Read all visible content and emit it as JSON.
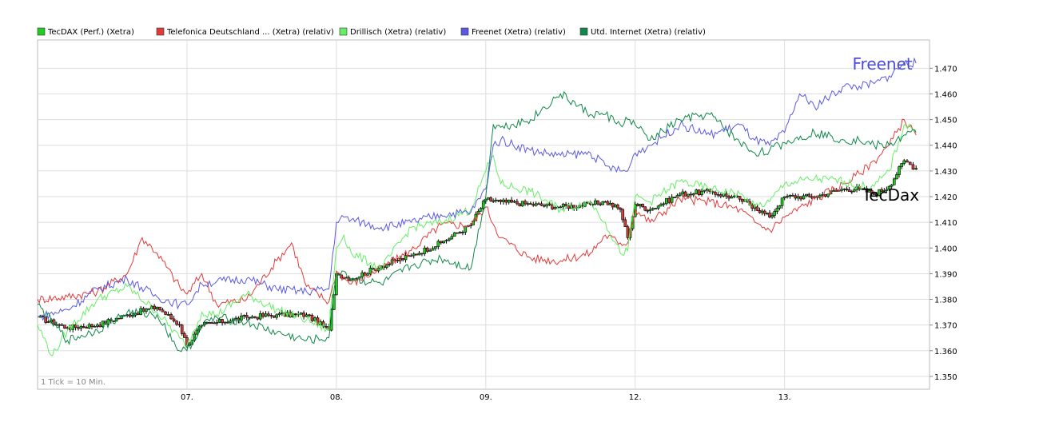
{
  "chart_data": {
    "type": "line",
    "footnote": "1 Tick = 10 Min.",
    "annotations": [
      {
        "text": "Freenet",
        "series": "Freenet (Xetra) (relativ)",
        "x": 5.55,
        "y": 1.4695,
        "color": "#4b4bd6"
      },
      {
        "text": "TecDax",
        "series": "TecDAX (Perf.) (Xetra)",
        "x": 5.55,
        "y": 1.421,
        "color": "#000000"
      }
    ],
    "x_ticks": [
      {
        "x": 1,
        "label": "07."
      },
      {
        "x": 2,
        "label": "08."
      },
      {
        "x": 3,
        "label": "09."
      },
      {
        "x": 4,
        "label": "12."
      },
      {
        "x": 5,
        "label": "13."
      }
    ],
    "xlim": [
      0,
      5.97
    ],
    "ylim": [
      1.345,
      1.481
    ],
    "y_ticks": [
      1.35,
      1.36,
      1.37,
      1.38,
      1.39,
      1.4,
      1.41,
      1.42,
      1.43,
      1.44,
      1.45,
      1.46,
      1.47
    ],
    "y_tick_labels": [
      "1.350",
      "1.360",
      "1.370",
      "1.380",
      "1.390",
      "1.400",
      "1.410",
      "1.420",
      "1.430",
      "1.440",
      "1.450",
      "1.460",
      "1.470"
    ],
    "grid": true,
    "legend_position": "top",
    "series": [
      {
        "name": "TecDAX (Perf.) (Xetra)",
        "color": "#22cc22",
        "style": "candlestick",
        "x": [
          0,
          0.2,
          0.4,
          0.6,
          0.8,
          0.95,
          1.0,
          1.1,
          1.2,
          1.4,
          1.6,
          1.8,
          1.95,
          2.0,
          2.1,
          2.3,
          2.5,
          2.7,
          2.9,
          3.0,
          3.1,
          3.3,
          3.5,
          3.7,
          3.8,
          3.9,
          3.95,
          4.0,
          4.1,
          4.3,
          4.5,
          4.7,
          4.8,
          4.9,
          5.0,
          5.2,
          5.4,
          5.5,
          5.6,
          5.7,
          5.8,
          5.88
        ],
        "y": [
          1.373,
          1.369,
          1.37,
          1.374,
          1.377,
          1.37,
          1.362,
          1.37,
          1.371,
          1.373,
          1.374,
          1.374,
          1.368,
          1.39,
          1.388,
          1.393,
          1.397,
          1.402,
          1.409,
          1.419,
          1.418,
          1.417,
          1.416,
          1.417,
          1.418,
          1.415,
          1.404,
          1.417,
          1.415,
          1.421,
          1.422,
          1.419,
          1.416,
          1.412,
          1.42,
          1.42,
          1.423,
          1.423,
          1.421,
          1.424,
          1.434,
          1.431
        ]
      },
      {
        "name": "Telefonica Deutschland ... (Xetra) (relativ)",
        "color": "#e23b3b",
        "style": "line",
        "x": [
          0,
          0.2,
          0.4,
          0.6,
          0.7,
          0.8,
          0.95,
          1.0,
          1.1,
          1.2,
          1.4,
          1.6,
          1.7,
          1.8,
          1.95,
          2.0,
          2.1,
          2.3,
          2.5,
          2.7,
          2.9,
          3.0,
          3.1,
          3.3,
          3.5,
          3.7,
          3.8,
          3.9,
          3.95,
          4.0,
          4.1,
          4.3,
          4.5,
          4.7,
          4.8,
          4.9,
          5.0,
          5.2,
          5.4,
          5.5,
          5.6,
          5.7,
          5.8,
          5.88
        ],
        "y": [
          1.38,
          1.381,
          1.383,
          1.39,
          1.404,
          1.398,
          1.385,
          1.382,
          1.39,
          1.378,
          1.38,
          1.395,
          1.402,
          1.385,
          1.379,
          1.391,
          1.386,
          1.392,
          1.399,
          1.409,
          1.409,
          1.416,
          1.404,
          1.396,
          1.395,
          1.398,
          1.405,
          1.402,
          1.402,
          1.415,
          1.41,
          1.419,
          1.418,
          1.415,
          1.41,
          1.407,
          1.412,
          1.419,
          1.425,
          1.429,
          1.434,
          1.44,
          1.45,
          1.444
        ]
      },
      {
        "name": "Drillisch (Xetra) (relativ)",
        "color": "#66ee66",
        "style": "line",
        "x": [
          0,
          0.1,
          0.2,
          0.4,
          0.6,
          0.8,
          0.95,
          1.0,
          1.1,
          1.2,
          1.4,
          1.6,
          1.8,
          1.95,
          2.0,
          2.05,
          2.1,
          2.3,
          2.5,
          2.7,
          2.9,
          3.0,
          3.05,
          3.1,
          3.3,
          3.5,
          3.7,
          3.8,
          3.9,
          3.95,
          4.0,
          4.1,
          4.3,
          4.5,
          4.7,
          4.8,
          4.9,
          5.0,
          5.2,
          5.4,
          5.5,
          5.6,
          5.7,
          5.8,
          5.88
        ],
        "y": [
          1.37,
          1.358,
          1.368,
          1.38,
          1.385,
          1.375,
          1.365,
          1.362,
          1.375,
          1.374,
          1.382,
          1.376,
          1.372,
          1.368,
          1.4,
          1.405,
          1.398,
          1.392,
          1.408,
          1.41,
          1.415,
          1.43,
          1.436,
          1.425,
          1.422,
          1.415,
          1.418,
          1.41,
          1.398,
          1.399,
          1.42,
          1.418,
          1.426,
          1.423,
          1.421,
          1.416,
          1.418,
          1.425,
          1.427,
          1.426,
          1.424,
          1.424,
          1.43,
          1.448,
          1.446
        ]
      },
      {
        "name": "Freenet (Xetra) (relativ)",
        "color": "#5a5ae0",
        "style": "line",
        "x": [
          0,
          0.2,
          0.4,
          0.6,
          0.8,
          0.95,
          1.0,
          1.1,
          1.2,
          1.4,
          1.6,
          1.8,
          1.95,
          2.0,
          2.05,
          2.1,
          2.3,
          2.5,
          2.7,
          2.9,
          3.0,
          3.05,
          3.1,
          3.3,
          3.5,
          3.7,
          3.8,
          3.9,
          3.95,
          4.0,
          4.1,
          4.3,
          4.5,
          4.7,
          4.8,
          4.9,
          5.0,
          5.1,
          5.2,
          5.4,
          5.5,
          5.6,
          5.7,
          5.8,
          5.88
        ],
        "y": [
          1.373,
          1.376,
          1.384,
          1.388,
          1.381,
          1.378,
          1.378,
          1.386,
          1.387,
          1.388,
          1.384,
          1.383,
          1.384,
          1.41,
          1.412,
          1.411,
          1.408,
          1.41,
          1.413,
          1.414,
          1.423,
          1.44,
          1.442,
          1.438,
          1.436,
          1.437,
          1.432,
          1.43,
          1.43,
          1.437,
          1.44,
          1.448,
          1.444,
          1.448,
          1.442,
          1.44,
          1.445,
          1.46,
          1.455,
          1.463,
          1.463,
          1.464,
          1.467,
          1.472,
          1.472
        ]
      },
      {
        "name": "Utd. Internet (Xetra) (relativ)",
        "color": "#11884a",
        "style": "line",
        "x": [
          0,
          0.2,
          0.4,
          0.6,
          0.8,
          0.95,
          1.0,
          1.1,
          1.2,
          1.4,
          1.6,
          1.8,
          1.95,
          2.0,
          2.05,
          2.1,
          2.3,
          2.5,
          2.7,
          2.9,
          3.0,
          3.05,
          3.1,
          3.3,
          3.5,
          3.7,
          3.8,
          3.9,
          3.95,
          4.0,
          4.1,
          4.3,
          4.5,
          4.7,
          4.8,
          4.9,
          5.0,
          5.2,
          5.4,
          5.5,
          5.6,
          5.7,
          5.8,
          5.88
        ],
        "y": [
          1.378,
          1.364,
          1.368,
          1.375,
          1.374,
          1.36,
          1.36,
          1.37,
          1.373,
          1.371,
          1.367,
          1.364,
          1.365,
          1.39,
          1.391,
          1.388,
          1.386,
          1.393,
          1.396,
          1.392,
          1.42,
          1.448,
          1.447,
          1.45,
          1.46,
          1.452,
          1.452,
          1.448,
          1.45,
          1.448,
          1.442,
          1.45,
          1.452,
          1.441,
          1.437,
          1.438,
          1.441,
          1.445,
          1.442,
          1.442,
          1.44,
          1.44,
          1.444,
          1.445
        ]
      }
    ]
  }
}
